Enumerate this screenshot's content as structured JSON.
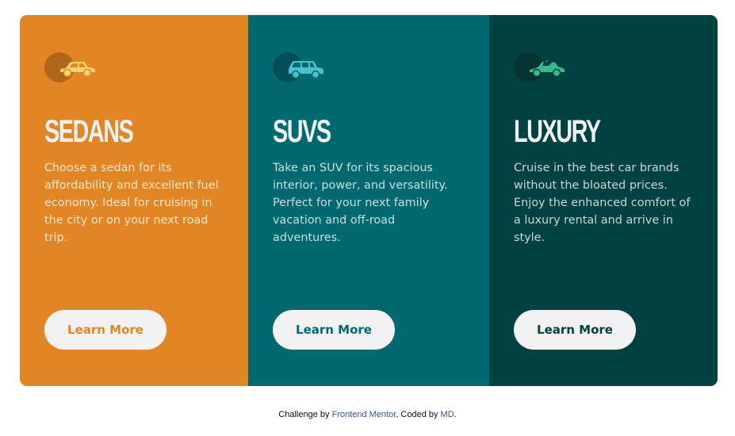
{
  "cards": [
    {
      "title": "Sedans",
      "icon": "sedan-car-icon",
      "text": "Choose a sedan for its affordability and excellent fuel economy. Ideal for cruising in the city or on your next road trip.",
      "button_label": "Learn More",
      "background": "#e28625"
    },
    {
      "title": "SUVs",
      "icon": "suv-car-icon",
      "text": "Take an SUV for its spacious interior, power, and versatility. Perfect for your next family vacation and off-road adventures.",
      "button_label": "Learn More",
      "background": "#006970"
    },
    {
      "title": "Luxury",
      "icon": "luxury-car-icon",
      "text": "Cruise in the best car brands without the bloated prices. Enjoy the enhanced comfort of a luxury rental and arrive in style.",
      "button_label": "Learn More",
      "background": "#004241"
    }
  ],
  "attribution": {
    "prefix": "Challenge by ",
    "mentor_link": "Frontend Mentor",
    "middle": ". Coded by ",
    "author_link": "MD",
    "suffix": "."
  },
  "colors": {
    "button_background": "#f2f2f2",
    "link": "#3e52a3"
  }
}
